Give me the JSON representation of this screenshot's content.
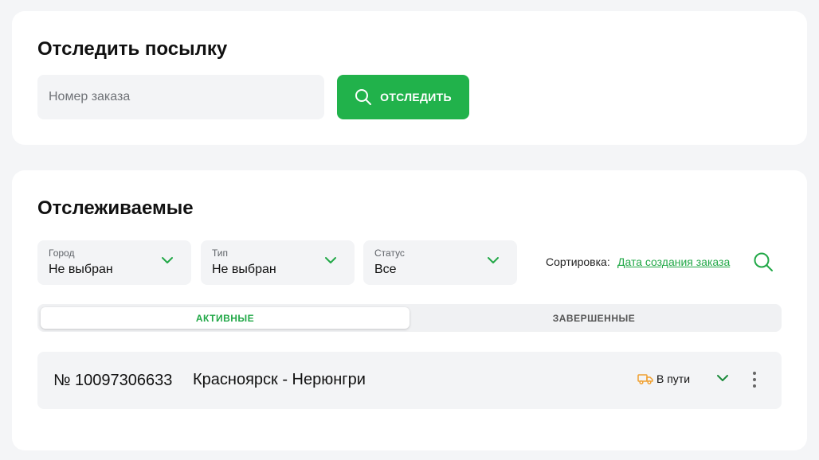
{
  "track_card": {
    "title": "Отследить посылку",
    "input_placeholder": "Номер заказа",
    "input_value": "",
    "button_label": "ОТСЛЕДИТЬ",
    "button_icon": "search-icon"
  },
  "tracked_card": {
    "title": "Отслеживаемые",
    "filters": {
      "city": {
        "label": "Город",
        "value": "Не выбран"
      },
      "type": {
        "label": "Тип",
        "value": "Не выбран"
      },
      "status": {
        "label": "Статус",
        "value": "Все"
      }
    },
    "sort": {
      "label": "Сортировка:",
      "value": "Дата создания заказа"
    },
    "tabs": [
      {
        "label": "АКТИВНЫЕ",
        "active": true
      },
      {
        "label": "ЗАВЕРШЕННЫЕ",
        "active": false
      }
    ],
    "orders": [
      {
        "number": "№ 10097306633",
        "route": "Красноярск - Нерюнгри",
        "status": "В пути",
        "status_icon": "truck-icon"
      }
    ]
  },
  "colors": {
    "accent": "#21b24b",
    "accent_text": "#21a847",
    "status_icon": "#f0a030",
    "page_bg": "#f4f5f7",
    "field_bg": "#f3f4f6"
  }
}
